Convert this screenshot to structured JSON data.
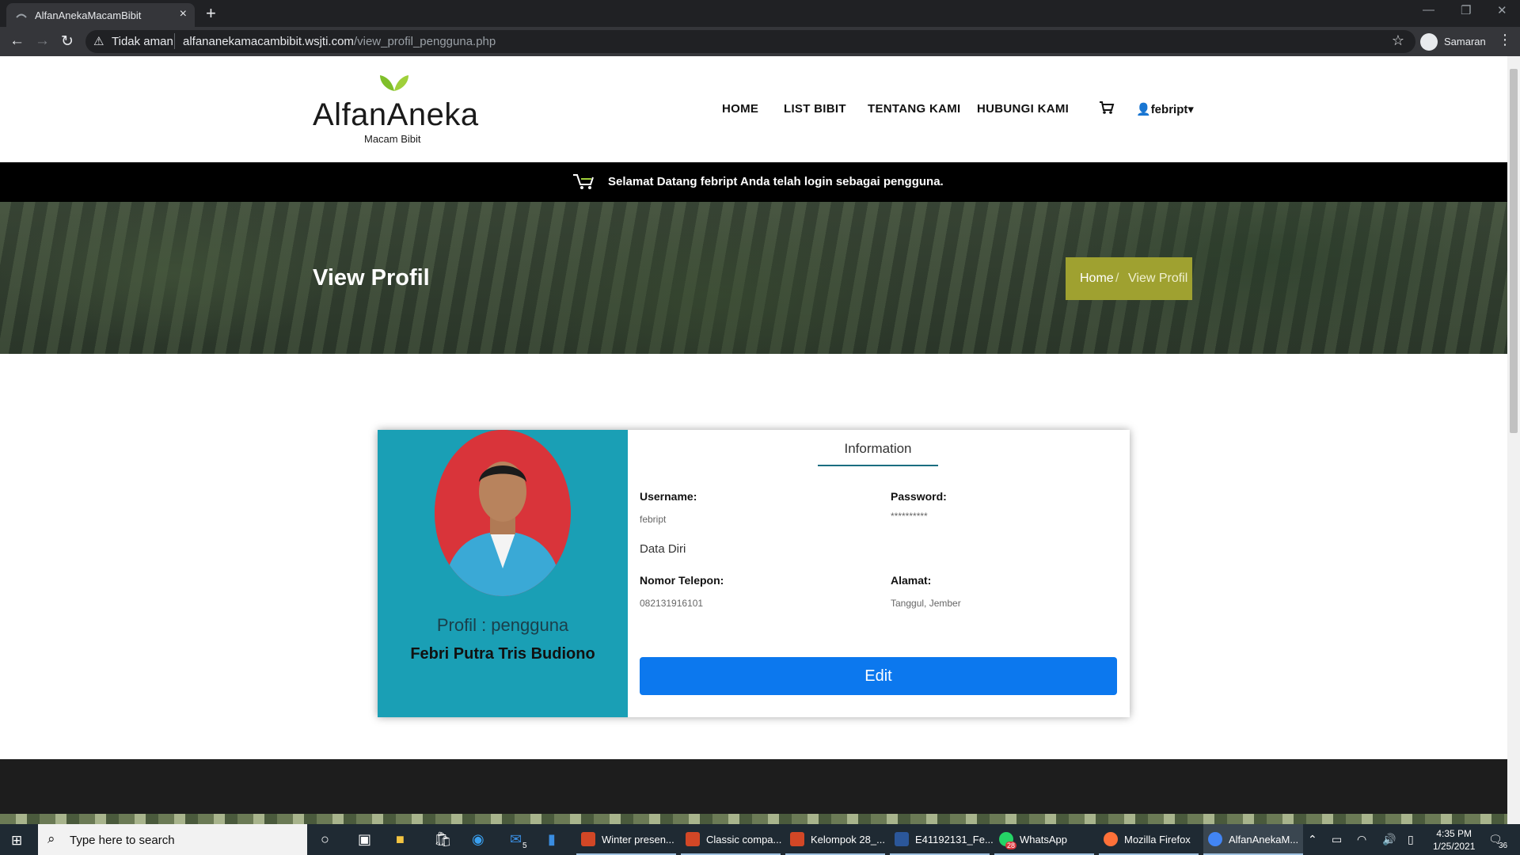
{
  "browser": {
    "tab_title": "AlfanAnekaMacamBibit",
    "not_secure": "Tidak aman",
    "url_host": "alfananekamacambibit.wsjti.com",
    "url_path": "/view_profil_pengguna.php",
    "profile_name": "Samaran"
  },
  "site": {
    "logo_text": "AlfanAneka",
    "logo_subtext": "Macam Bibit",
    "nav": [
      "HOME",
      "LIST BIBIT",
      "TENTANG KAMI",
      "HUBUNGI KAMI"
    ],
    "user": "febript",
    "welcome": {
      "prefix": "Selamat Datang ",
      "user": "febript",
      "middle": " Anda telah login sebagai ",
      "role": "pengguna",
      "suffix": "."
    },
    "page_title": "View Profil",
    "breadcrumb": {
      "home": "Home",
      "separator": "/",
      "current": "View Profil"
    }
  },
  "profile": {
    "role_label": "Profil : pengguna",
    "full_name": "Febri Putra Tris Budiono",
    "tab_label": "Information",
    "username_label": "Username:",
    "username_value": "febript",
    "password_label": "Password:",
    "password_value": "**********",
    "section_label": "Data Diri",
    "phone_label": "Nomor Telepon:",
    "phone_value": "082131916101",
    "address_label": "Alamat:",
    "address_value": "Tanggul, Jember",
    "edit_label": "Edit"
  },
  "taskbar": {
    "search_placeholder": "Type here to search",
    "mail_badge": "5",
    "whatsapp_badge": "28",
    "notification_badge": "36",
    "apps": [
      {
        "label": "Winter presen...",
        "color": "#d24726"
      },
      {
        "label": "Classic compa...",
        "color": "#d24726"
      },
      {
        "label": "Kelompok 28_...",
        "color": "#d24726"
      },
      {
        "label": "E41192131_Fe...",
        "color": "#2b579a"
      },
      {
        "label": "WhatsApp",
        "color": "#25d366"
      },
      {
        "label": "Mozilla Firefox",
        "color": "#ff7139"
      },
      {
        "label": "AlfanAnekaM...",
        "color": "#4285f4"
      }
    ],
    "time": "4:35 PM",
    "date": "1/25/2021"
  },
  "colors": {
    "profile_panel": "#1a9fb5",
    "breadcrumb_bg": "#9fa130",
    "edit_button": "#0c78ee",
    "welcome_bar": "#000000"
  }
}
